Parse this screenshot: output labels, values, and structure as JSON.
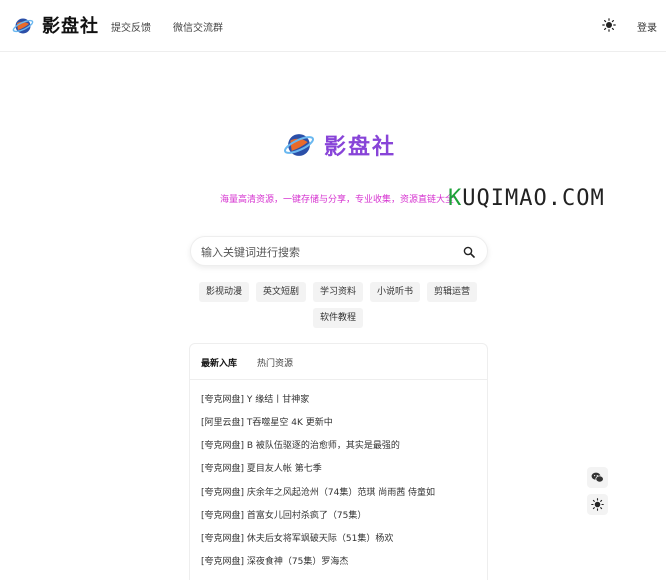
{
  "header": {
    "brand": "影盘社",
    "nav": [
      "提交反馈",
      "微信交流群"
    ],
    "login": "登录"
  },
  "hero": {
    "title": "影盘社",
    "tagline": "海量高清资源，一键存储与分享，专业收集，资源直链大全",
    "watermark_prefix": "K",
    "watermark_rest": "UQIMAO.COM"
  },
  "search": {
    "placeholder": "输入关键词进行搜索"
  },
  "tags": [
    "影视动漫",
    "英文短剧",
    "学习资料",
    "小说听书",
    "剪辑运营",
    "软件教程"
  ],
  "card": {
    "tabs": [
      "最新入库",
      "热门资源"
    ],
    "items": [
      "[夸克网盘] Y 缘结丨甘神家",
      "[阿里云盘] T吞噬星空 4K 更新中",
      "[夸克网盘] B 被队伍驱逐的治愈师，其实是最强的",
      "[夸克网盘] 夏目友人帐 第七季",
      "[夸克网盘] 庆余年之风起沧州（74集）范琪 尚雨茜 侍童如",
      "[夸克网盘] 首富女儿回村杀疯了（75集）",
      "[夸克网盘] 休夫后女将军飒破天际（51集）杨欢",
      "[夸克网盘] 深夜食神（75集）罗海杰"
    ]
  },
  "colors": {
    "brand_purple": "#8844d8",
    "tagline_pink": "#d633d0",
    "watermark_green": "#1fa23a"
  },
  "icons": {
    "logo": "planet-logo-icon",
    "theme": "sun-icon",
    "search": "search-icon",
    "wechat": "wechat-icon"
  }
}
